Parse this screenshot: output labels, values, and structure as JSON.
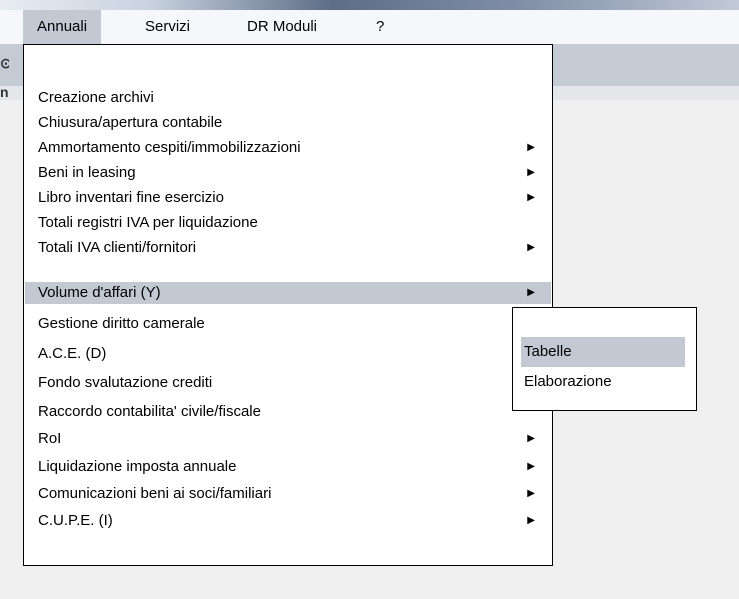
{
  "menubar": {
    "items": [
      {
        "label": "Annuali"
      },
      {
        "label": "Servizi"
      },
      {
        "label": "DR Moduli"
      },
      {
        "label": "?"
      }
    ]
  },
  "background_fragments": {
    "toolbar_glyph": "⊙",
    "left_text": "ne"
  },
  "main_menu": {
    "items": [
      {
        "label": "Creazione archivi",
        "submenu": false
      },
      {
        "label": "Chiusura/apertura contabile",
        "submenu": false
      },
      {
        "label": "Ammortamento cespiti/immobilizzazioni",
        "submenu": true
      },
      {
        "label": "Beni in leasing",
        "submenu": true
      },
      {
        "label": "Libro inventari fine esercizio",
        "submenu": true
      },
      {
        "label": "Totali registri IVA per liquidazione",
        "submenu": false
      },
      {
        "label": "Totali IVA clienti/fornitori",
        "submenu": true
      },
      {
        "label": "Volume d'affari (Y)",
        "submenu": true
      },
      {
        "label": "Gestione diritto camerale",
        "submenu": false
      },
      {
        "label": "A.C.E. (D)",
        "submenu": false
      },
      {
        "label": "Fondo svalutazione crediti",
        "submenu": false
      },
      {
        "label": "Raccordo contabilita' civile/fiscale",
        "submenu": false
      },
      {
        "label": "RoI",
        "submenu": true
      },
      {
        "label": "Liquidazione imposta annuale",
        "submenu": true
      },
      {
        "label": "Comunicazioni beni ai soci/familiari",
        "submenu": true
      },
      {
        "label": "C.U.P.E. (I)",
        "submenu": true
      }
    ],
    "arrow_glyph": "▶"
  },
  "submenu": {
    "items": [
      {
        "label": "Tabelle"
      },
      {
        "label": "Elaborazione"
      }
    ]
  }
}
